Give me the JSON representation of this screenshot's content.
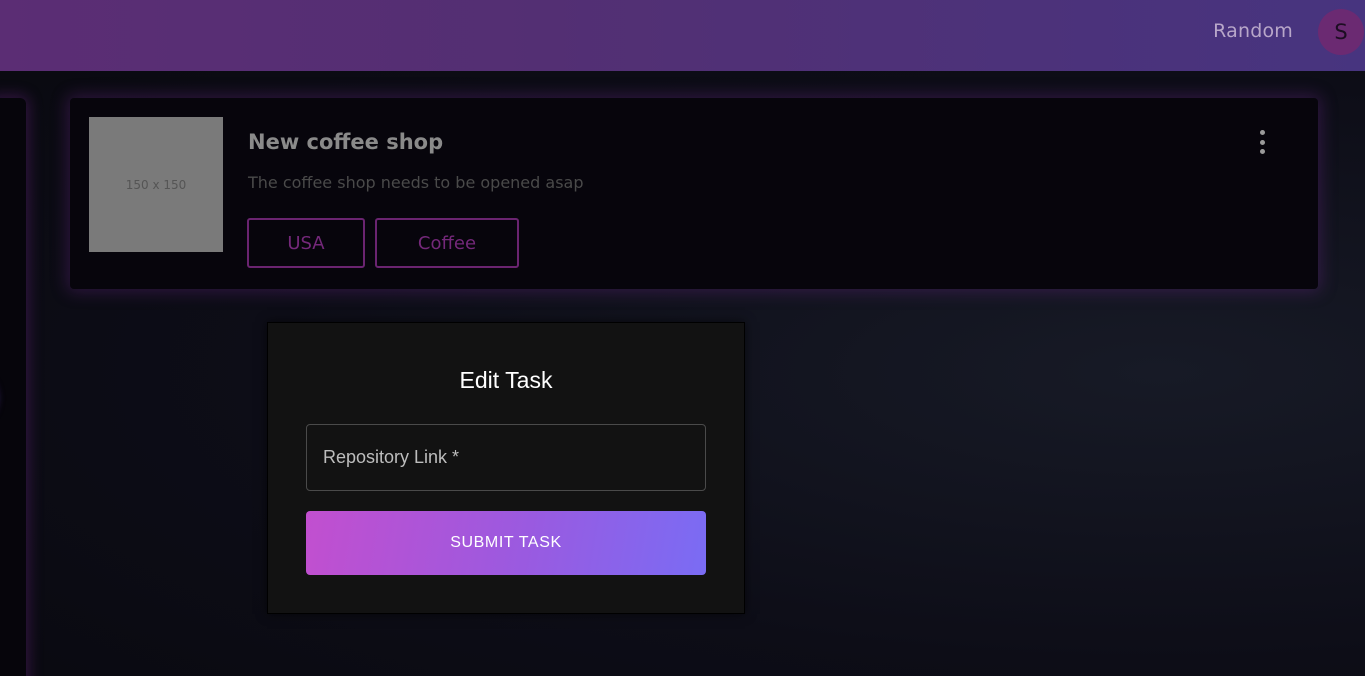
{
  "header": {
    "user_name": "Random",
    "avatar_initial": "S"
  },
  "sidebar": {
    "items": [
      {
        "icon": "circle-active"
      },
      {
        "icon": "circle-outline"
      },
      {
        "icon": "circle-outline"
      },
      {
        "icon": "circle-outline"
      }
    ]
  },
  "task": {
    "image_placeholder": "150 x 150",
    "title": "New coffee shop",
    "description": "The coffee shop needs to be opened asap",
    "tags": [
      "USA",
      "Coffee"
    ],
    "menu_icon": "more-vertical-icon"
  },
  "modal": {
    "title": "Edit Task",
    "repo_placeholder": "Repository Link *",
    "submit_label": "SUBMIT TASK"
  },
  "colors": {
    "accent_start": "#c24fcf",
    "accent_end": "#7a6cf4",
    "tag_border": "#6a2470",
    "header_gradient_start": "#5b2d74",
    "header_gradient_end": "#47347f"
  }
}
